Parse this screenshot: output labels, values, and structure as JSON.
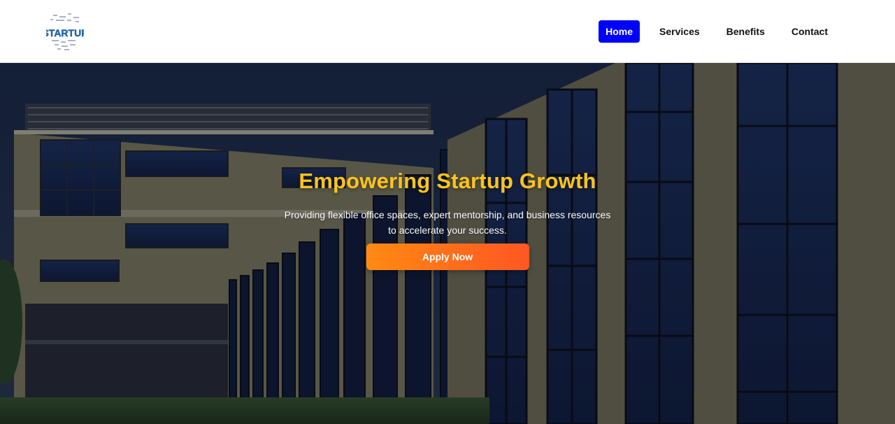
{
  "header": {
    "logo_text": "STARTUP",
    "nav": [
      {
        "label": "Home",
        "active": true
      },
      {
        "label": "Services",
        "active": false
      },
      {
        "label": "Benefits",
        "active": false
      },
      {
        "label": "Contact",
        "active": false
      }
    ]
  },
  "hero": {
    "title": "Empowering Startup Growth",
    "subtitle": "Providing flexible office spaces, expert mentorship, and business resources to accelerate your success.",
    "cta_label": "Apply Now"
  },
  "colors": {
    "nav_active_bg": "#0000ff",
    "title_color": "#ffc41a",
    "cta_gradient_start": "#ff8a12",
    "cta_gradient_end": "#ff5722"
  }
}
